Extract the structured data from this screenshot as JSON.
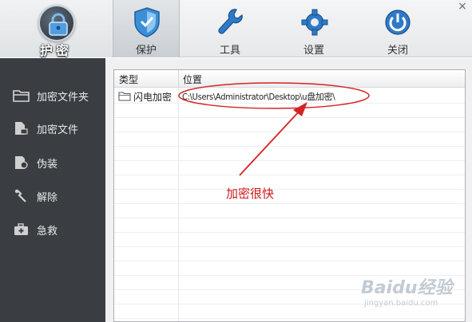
{
  "window": {
    "close_icon": "×"
  },
  "toolbar": {
    "logo_label": "护密",
    "tools": [
      {
        "label": "保护",
        "icon": "shield-icon",
        "active": true
      },
      {
        "label": "工具",
        "icon": "wrench-icon"
      },
      {
        "label": "设置",
        "icon": "gear-icon"
      },
      {
        "label": "关闭",
        "icon": "power-icon"
      }
    ]
  },
  "sidebar": {
    "items": [
      {
        "label": "加密文件夹",
        "icon": "folder-icon"
      },
      {
        "label": "加密文件",
        "icon": "file-lock-icon"
      },
      {
        "label": "伪装",
        "icon": "disguise-icon"
      },
      {
        "label": "解除",
        "icon": "unlock-icon"
      },
      {
        "label": "急救",
        "icon": "first-aid-icon"
      }
    ]
  },
  "list": {
    "columns": [
      "类型",
      "位置"
    ],
    "rows": [
      {
        "type": "闪电加密",
        "path": "C:\\Users\\Administrator\\Desktop\\u盘加密\\"
      }
    ]
  },
  "annotation": {
    "text": "加密很快",
    "color": "#cc1a1a"
  },
  "watermark": {
    "line1": "Baidu经验",
    "line2": "jingyan.baidu.com"
  }
}
